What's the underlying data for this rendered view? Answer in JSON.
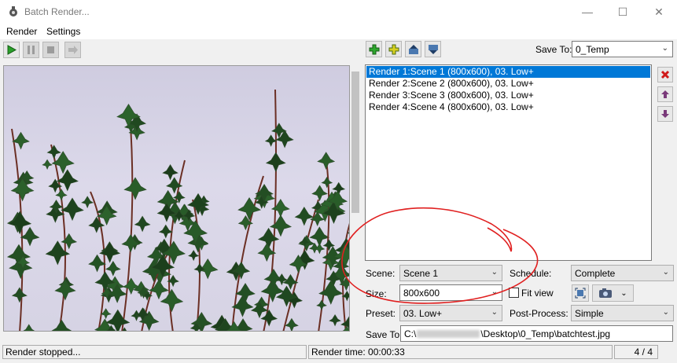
{
  "window": {
    "title": "Batch Render..."
  },
  "menu": {
    "items": [
      "Render",
      "Settings"
    ]
  },
  "toolbar": {
    "left_icons": [
      "play-icon",
      "pause-icon",
      "stop-icon",
      "export-icon"
    ],
    "list_icons": [
      "add-icon",
      "add-copy-icon",
      "move-up-icon",
      "move-down-icon"
    ],
    "save_to_label": "Save To:",
    "save_to_value": "0_Temp"
  },
  "render_list": {
    "items": [
      "Render 1:Scene 1 (800x600), 03. Low+",
      "Render 2:Scene 2 (800x600), 03. Low+",
      "Render 3:Scene 3 (800x600), 03. Low+",
      "Render 4:Scene 4 (800x600), 03. Low+"
    ],
    "selected_index": 0
  },
  "form": {
    "scene_label": "Scene:",
    "scene_value": "Scene 1",
    "schedule_label": "Schedule:",
    "schedule_value": "Complete",
    "size_label": "Size:",
    "size_value": "800x600",
    "fit_view_label": "Fit view",
    "fit_view_checked": false,
    "preset_label": "Preset:",
    "preset_value": "03. Low+",
    "postprocess_label": "Post-Process:",
    "postprocess_value": "Simple",
    "saveto_label": "Save To:",
    "saveto_value_start": "C:\\",
    "saveto_value_end": "\\Desktop\\0_Temp\\batchtest.jpg"
  },
  "status": {
    "message": "Render stopped...",
    "render_time": "Render time: 00:00:33",
    "progress": "4 / 4"
  },
  "colors": {
    "selection": "#0078d7",
    "annotation": "#e02020",
    "leaf": "#2e4a2a",
    "vine": "#6b2f24"
  }
}
